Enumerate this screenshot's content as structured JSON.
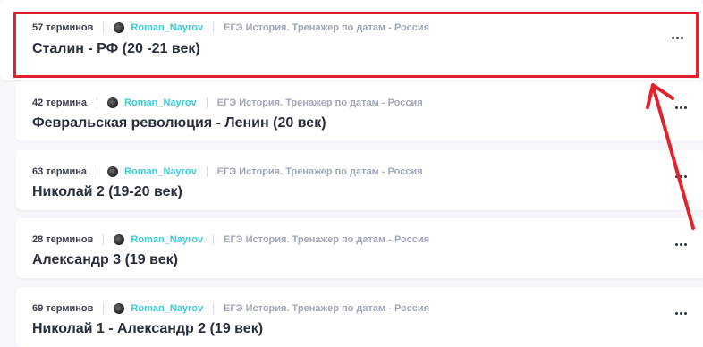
{
  "sets": [
    {
      "terms": "57 терминов",
      "author": "Roman_Nayrov",
      "set_name": "ЕГЭ История. Тренажер по датам - Россия",
      "title": "Сталин - РФ (20 -21 век)"
    },
    {
      "terms": "42 термина",
      "author": "Roman_Nayrov",
      "set_name": "ЕГЭ История. Тренажер по датам - Россия",
      "title": "Февральская революция - Ленин (20 век)"
    },
    {
      "terms": "63 термина",
      "author": "Roman_Nayrov",
      "set_name": "ЕГЭ История. Тренажер по датам - Россия",
      "title": "Николай 2 (19-20 век)"
    },
    {
      "terms": "28 терминов",
      "author": "Roman_Nayrov",
      "set_name": "ЕГЭ История. Тренажер по датам - Россия",
      "title": "Александр 3 (19 век)"
    },
    {
      "terms": "69 терминов",
      "author": "Roman_Nayrov",
      "set_name": "ЕГЭ История. Тренажер по датам - Россия",
      "title": "Николай 1 - Александр 2 (19 век)"
    }
  ],
  "icons": {
    "more": "more-horizontal-icon",
    "avatar": "user-avatar"
  },
  "colors": {
    "author": "#3ccbd8",
    "highlight": "#e0232c",
    "title": "#282e3e",
    "set_name": "#a1a6b8"
  }
}
